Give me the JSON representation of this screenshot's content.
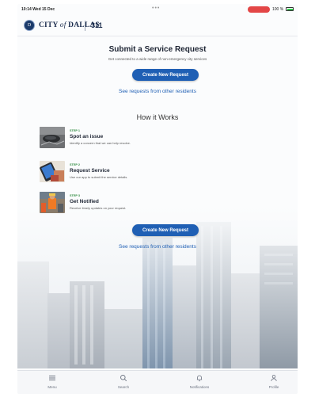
{
  "status_bar": {
    "time": "10:14 Wed 15 Dec",
    "battery_text": "100 %"
  },
  "header": {
    "seal_text": "D",
    "brand_city": "CITY",
    "brand_of": "of",
    "brand_name": "DALLAS",
    "brand_service": "311"
  },
  "hero": {
    "title": "Submit a Service Request",
    "subtitle": "Get connected to a wide range of non-emergency city services",
    "primary_button": "Create New Request",
    "secondary_link": "See requests from other residents"
  },
  "how_it_works": {
    "heading": "How it Works",
    "steps": [
      {
        "num": "STEP 1",
        "title": "Spot an issue",
        "desc": "Identify a concern that we can help resolve."
      },
      {
        "num": "STEP 2",
        "title": "Request Service",
        "desc": "Use our app to submit the service details."
      },
      {
        "num": "STEP 3",
        "title": "Get Notified",
        "desc": "Receive timely updates on your request."
      }
    ]
  },
  "footer_cta": {
    "primary_button": "Create New Request",
    "secondary_link": "See requests from other residents"
  },
  "tab_bar": {
    "items": [
      {
        "label": "Menu",
        "icon": "menu-icon"
      },
      {
        "label": "Search",
        "icon": "search-icon"
      },
      {
        "label": "Notifications",
        "icon": "bell-icon"
      },
      {
        "label": "Profile",
        "icon": "person-icon"
      }
    ]
  },
  "colors": {
    "accent": "#1f5fb4",
    "step_label": "#2d8a3e",
    "status_pill": "#e34646"
  }
}
